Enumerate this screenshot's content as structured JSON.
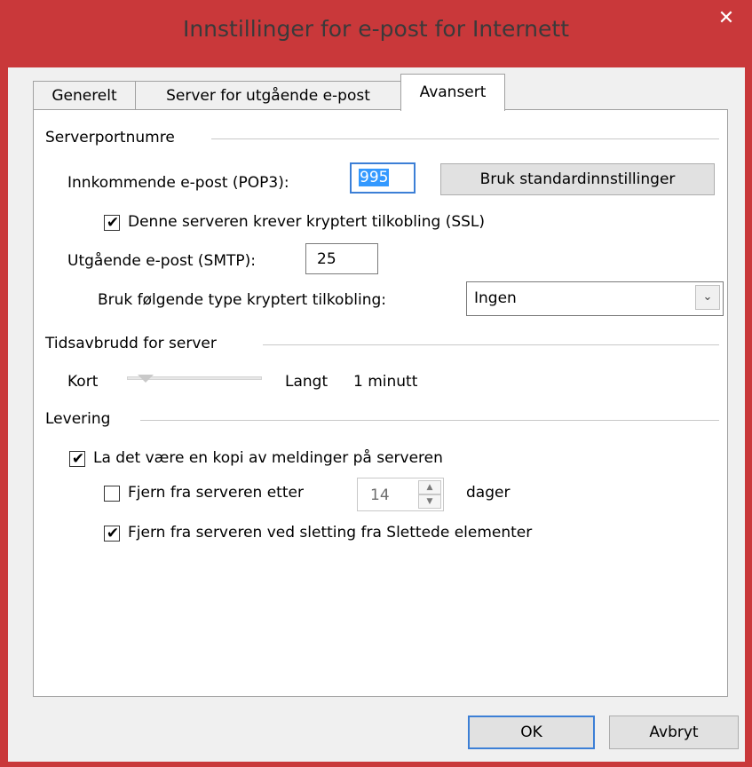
{
  "window": {
    "title": "Innstillinger for e-post for Internett",
    "close_symbol": "✕"
  },
  "tabs": [
    {
      "label": "Generelt"
    },
    {
      "label": "Server for utgående e-post"
    },
    {
      "label": "Avansert",
      "active": true
    }
  ],
  "ports": {
    "group_label": "Serverportnumre",
    "incoming_label": "Innkommende e-post (POP3):",
    "incoming_value": "995",
    "defaults_button": "Bruk standardinnstillinger",
    "ssl_label": "Denne serveren krever kryptert tilkobling (SSL)",
    "ssl_checked": true,
    "outgoing_label": "Utgående e-post (SMTP):",
    "outgoing_value": "25",
    "encryption_label": "Bruk følgende type kryptert tilkobling:",
    "encryption_value": "Ingen"
  },
  "timeout": {
    "group_label": "Tidsavbrudd for server",
    "short_label": "Kort",
    "long_label": "Langt",
    "value_text": "1 minutt",
    "level": 0.14
  },
  "delivery": {
    "group_label": "Levering",
    "keep_copy_label": "La det være en kopi av meldinger på serveren",
    "keep_copy_checked": true,
    "remove_after_label": "Fjern fra serveren etter",
    "remove_after_checked": false,
    "days_value": "14",
    "days_label": "dager",
    "remove_deleted_label": "Fjern fra serveren ved sletting fra Slettede elementer",
    "remove_deleted_checked": true
  },
  "footer": {
    "ok_label": "OK",
    "cancel_label": "Avbryt"
  },
  "colors": {
    "titlebar": "#c9383a",
    "dialog_bg": "#f0f0f0",
    "selection": "#3399ff",
    "default_button_border": "#3c7fd6"
  },
  "icons": {
    "close": "close-icon",
    "dropdown": "chevron-down-icon",
    "check": "checkmark-icon",
    "spin_up": "arrow-up-icon",
    "spin_down": "arrow-down-icon"
  }
}
